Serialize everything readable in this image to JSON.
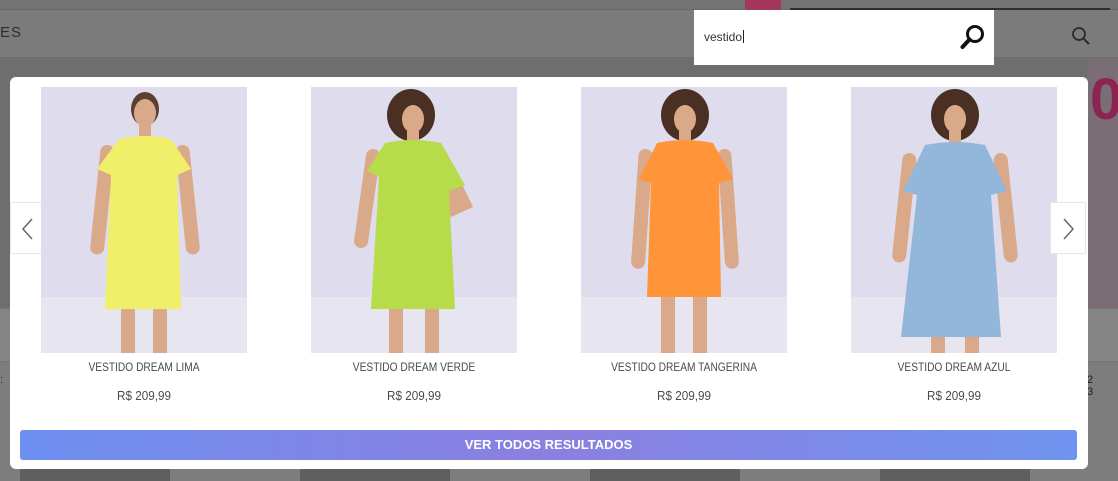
{
  "background": {
    "nav_partial_text": "ES",
    "pagination_partial": "2 3",
    "hero_partial_text": "0"
  },
  "search": {
    "value": "vestido",
    "submit_icon": "magnifier-icon",
    "header_icon": "search-icon"
  },
  "carousel": {
    "prev_icon": "chevron-left-icon",
    "next_icon": "chevron-right-icon",
    "products": [
      {
        "name": "VESTIDO DREAM LIMA",
        "price": "R$ 209,99",
        "dress_color": "#f0ef6a"
      },
      {
        "name": "VESTIDO DREAM VERDE",
        "price": "R$ 209,99",
        "dress_color": "#b6dc4a"
      },
      {
        "name": "VESTIDO DREAM TANGERINA",
        "price": "R$ 209,99",
        "dress_color": "#ff9438"
      },
      {
        "name": "VESTIDO DREAM AZUL",
        "price": "R$ 209,99",
        "dress_color": "#93b6db"
      }
    ]
  },
  "view_all_label": "VER TODOS RESULTADOS",
  "colors": {
    "accent_gradient_start": "#6d8ff0",
    "accent_gradient_mid": "#8b7fe0",
    "brand_pink": "#a3375e",
    "product_bg": "#dedcec"
  }
}
